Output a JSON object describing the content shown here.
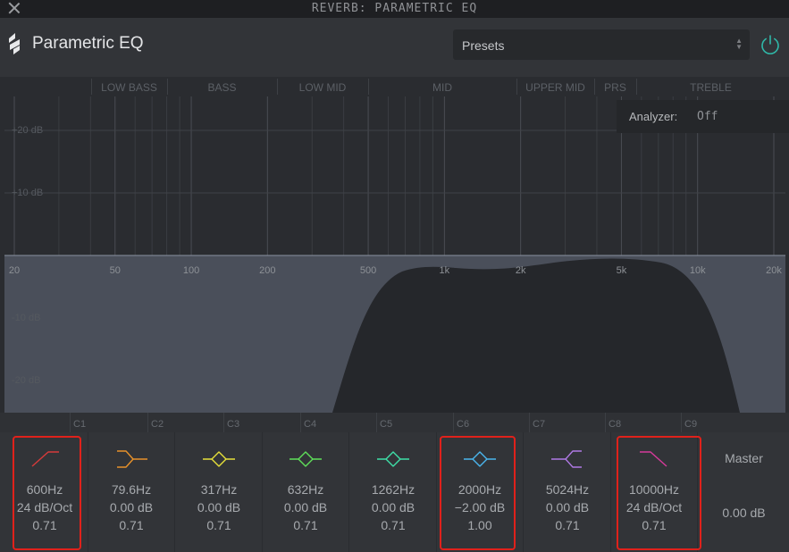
{
  "window": {
    "title": "REVERB: PARAMETRIC EQ"
  },
  "header": {
    "app_title": "Parametric EQ",
    "presets_label": "Presets",
    "logo_icon": "bolt-logo-icon",
    "power_icon": "power-icon",
    "accent_color": "#2fb8a8"
  },
  "graph": {
    "bands": [
      "LOW BASS",
      "BASS",
      "LOW MID",
      "MID",
      "UPPER MID",
      "PRS",
      "TREBLE"
    ],
    "freq_labels": [
      "20",
      "50",
      "100",
      "200",
      "500",
      "1k",
      "2k",
      "5k",
      "10k",
      "20k"
    ],
    "db_labels": [
      "+20 dB",
      "+10 dB",
      "-10 dB",
      "-20 dB"
    ],
    "analyzer": {
      "label": "Analyzer:",
      "value": "Off"
    }
  },
  "channels": [
    "C1",
    "C2",
    "C3",
    "C4",
    "C5",
    "C6",
    "C7",
    "C8",
    "C9"
  ],
  "eq_bands": [
    {
      "icon": "high-pass-filter-icon",
      "color": "#d63a3a",
      "freq": "600Hz",
      "gain": "24 dB/Oct",
      "q": "0.71",
      "highlighted": true
    },
    {
      "icon": "low-shelf-filter-icon",
      "color": "#e8922a",
      "freq": "79.6Hz",
      "gain": "0.00 dB",
      "q": "0.71",
      "highlighted": false
    },
    {
      "icon": "bell-filter-icon",
      "color": "#e6e03a",
      "freq": "317Hz",
      "gain": "0.00 dB",
      "q": "0.71",
      "highlighted": false
    },
    {
      "icon": "bell-filter-icon",
      "color": "#5fe05a",
      "freq": "632Hz",
      "gain": "0.00 dB",
      "q": "0.71",
      "highlighted": false
    },
    {
      "icon": "bell-filter-icon",
      "color": "#3ee0a8",
      "freq": "1262Hz",
      "gain": "0.00 dB",
      "q": "0.71",
      "highlighted": false
    },
    {
      "icon": "bell-filter-icon",
      "color": "#4ab6ee",
      "freq": "2000Hz",
      "gain": "−2.00 dB",
      "q": "1.00",
      "highlighted": true
    },
    {
      "icon": "high-shelf-filter-icon",
      "color": "#b07ae6",
      "freq": "5024Hz",
      "gain": "0.00 dB",
      "q": "0.71",
      "highlighted": false
    },
    {
      "icon": "low-pass-filter-icon",
      "color": "#d63a9a",
      "freq": "10000Hz",
      "gain": "24 dB/Oct",
      "q": "0.71",
      "highlighted": true
    }
  ],
  "master": {
    "label": "Master",
    "value": "0.00 dB"
  }
}
